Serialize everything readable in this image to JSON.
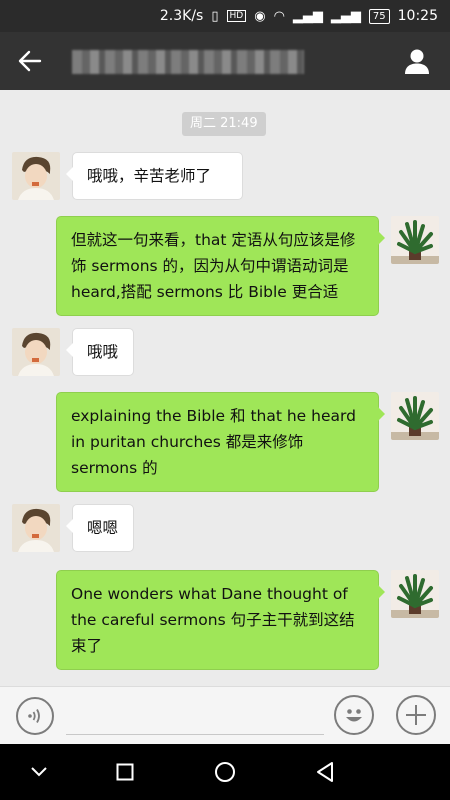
{
  "status_bar": {
    "speed": "2.3K/s",
    "hd": "HD",
    "battery": "75",
    "time": "10:25"
  },
  "header": {
    "title_blurred": true
  },
  "chat": {
    "timestamp": "周二 21:49",
    "messages": [
      {
        "side": "left",
        "text": "哦哦，辛苦老师了"
      },
      {
        "side": "right",
        "text": "但就这一句来看，that 定语从句应该是修饰 sermons 的，因为从句中谓语动词是 heard,搭配 sermons 比 Bible 更合适"
      },
      {
        "side": "left",
        "text": "哦哦"
      },
      {
        "side": "right",
        "text": "explaining the Bible 和 that he heard in puritan churches 都是来修饰 sermons 的"
      },
      {
        "side": "left",
        "text": "嗯嗯"
      },
      {
        "side": "right",
        "text": "One wonders what Dane thought of the careful sermons 句子主干就到这结束了"
      }
    ]
  },
  "colors": {
    "header_bg": "#333333",
    "chat_bg": "#ebebeb",
    "bubble_out": "#9fe658",
    "bubble_in": "#ffffff"
  },
  "icons": {
    "back": "arrow-left-icon",
    "profile": "person-icon",
    "voice": "voice-icon",
    "emoji": "emoji-icon",
    "plus": "plus-icon",
    "nav_back": "triangle-back-icon",
    "nav_home": "circle-home-icon",
    "nav_recent": "square-recent-icon",
    "nav_down": "chevron-down-icon"
  }
}
